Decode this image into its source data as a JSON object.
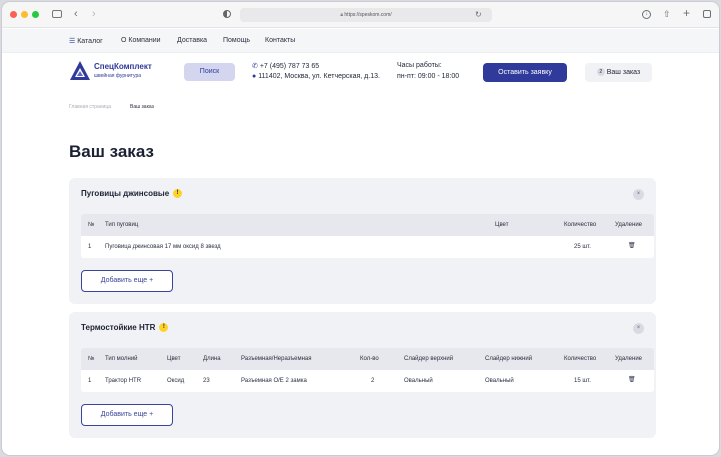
{
  "browser": {
    "url": "https://speskom.com/"
  },
  "nav": {
    "catalog": "Каталог",
    "about": "О Компании",
    "delivery": "Доставка",
    "help": "Помощь",
    "contacts": "Контакты"
  },
  "header": {
    "logo_name": "СпецКомплект",
    "logo_sub": "швейная фурнитура",
    "search_label": "Поиск",
    "phone": "+7 (495) 787 73 65",
    "address": "111402, Москва, ул. Кетчерская, д.13.",
    "hours_title": "Часы работы:",
    "hours": "пн-пт: 09:00 - 18:00",
    "order_button": "Оставить заявку",
    "cart_count": "2",
    "cart_label": "Ваш заказ"
  },
  "breadcrumb": {
    "home": "Главная страница",
    "current": "Ваш заказ"
  },
  "page": {
    "title": "Ваш заказ"
  },
  "orders": [
    {
      "title": "Пуговицы джинсовые",
      "headers": [
        "№",
        "Тип пуговиц",
        "Цвет",
        "Количество",
        "Удаление"
      ],
      "rows": [
        [
          "1",
          "Пуговица джинсовая 17 мм оксид 8 звезд",
          "",
          "25 шт."
        ]
      ],
      "add_label": "Добавить еще +"
    },
    {
      "title": "Термостойкие HTR",
      "headers": [
        "№",
        "Тип молний",
        "Цвет",
        "Длина",
        "Разъемная/Неразъемная",
        "Кол-во",
        "Слайдер верхний",
        "Слайдер нижний",
        "Количество",
        "Удаление"
      ],
      "rows": [
        [
          "1",
          "Трактор HTR",
          "Оксид",
          "23",
          "Разъемная О/Е 2 замка",
          "2",
          "Овальный",
          "Овальный",
          "15 шт."
        ]
      ],
      "add_label": "Добавить еще +"
    }
  ],
  "icons": {
    "warn": "!",
    "close": "×",
    "trash": "🗑"
  },
  "colors": {
    "accent": "#2f3a9a",
    "search_bg": "#d3d6ee",
    "warn": "#ffd228",
    "card_bg": "#f1f2f5"
  }
}
